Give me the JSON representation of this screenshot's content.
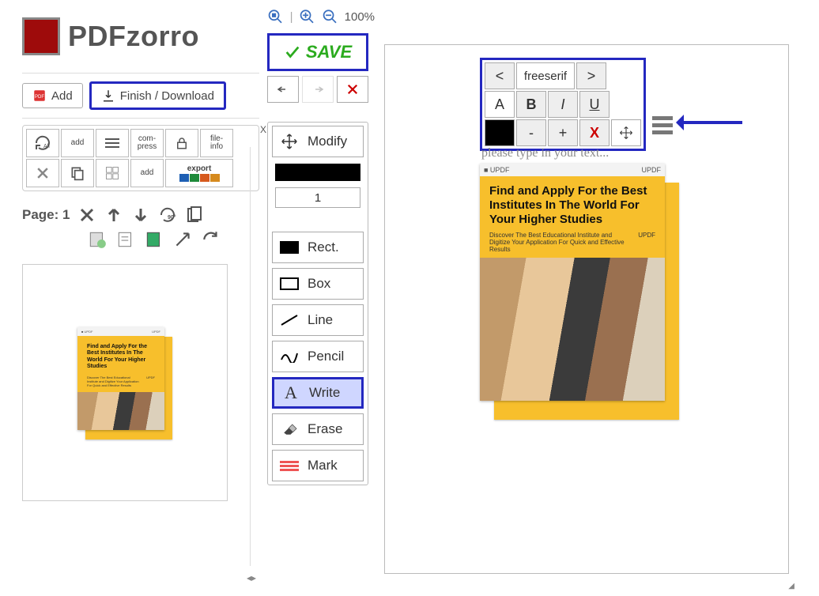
{
  "app": {
    "name": "PDFzorro"
  },
  "sidebar": {
    "add_label": "Add",
    "finish_label": "Finish / Download",
    "tools_row1": [
      "All",
      "add",
      "≡",
      "com-\npress",
      "🔒",
      "file-\ninfo"
    ],
    "tools_row2": [
      "✕",
      "⧉",
      "⊞",
      "add",
      "export",
      ""
    ],
    "page_label": "Page: 1"
  },
  "zoom": {
    "percent": "100%"
  },
  "save": {
    "label": "SAVE"
  },
  "tool_strip": {
    "modify": "Modify",
    "number": "1",
    "items": [
      {
        "key": "rect",
        "label": "Rect."
      },
      {
        "key": "box",
        "label": "Box"
      },
      {
        "key": "line",
        "label": "Line"
      },
      {
        "key": "pencil",
        "label": "Pencil"
      },
      {
        "key": "write",
        "label": "Write"
      },
      {
        "key": "erase",
        "label": "Erase"
      },
      {
        "key": "mark",
        "label": "Mark"
      }
    ],
    "selected": "write"
  },
  "text_toolbar": {
    "prev": "<",
    "font": "freeserif",
    "next": ">",
    "a": "A",
    "bold": "B",
    "italic": "I",
    "underline": "U",
    "minus": "-",
    "plus": "+",
    "delete": "X"
  },
  "canvas": {
    "placeholder": "please type in your text..."
  },
  "document": {
    "brand": "UPDF",
    "title": "Find and Apply For the Best Institutes In The World For Your Higher Studies",
    "subtitle": "Discover The Best Educational Institute and Digitize Your Application For Quick and Effective Results"
  }
}
